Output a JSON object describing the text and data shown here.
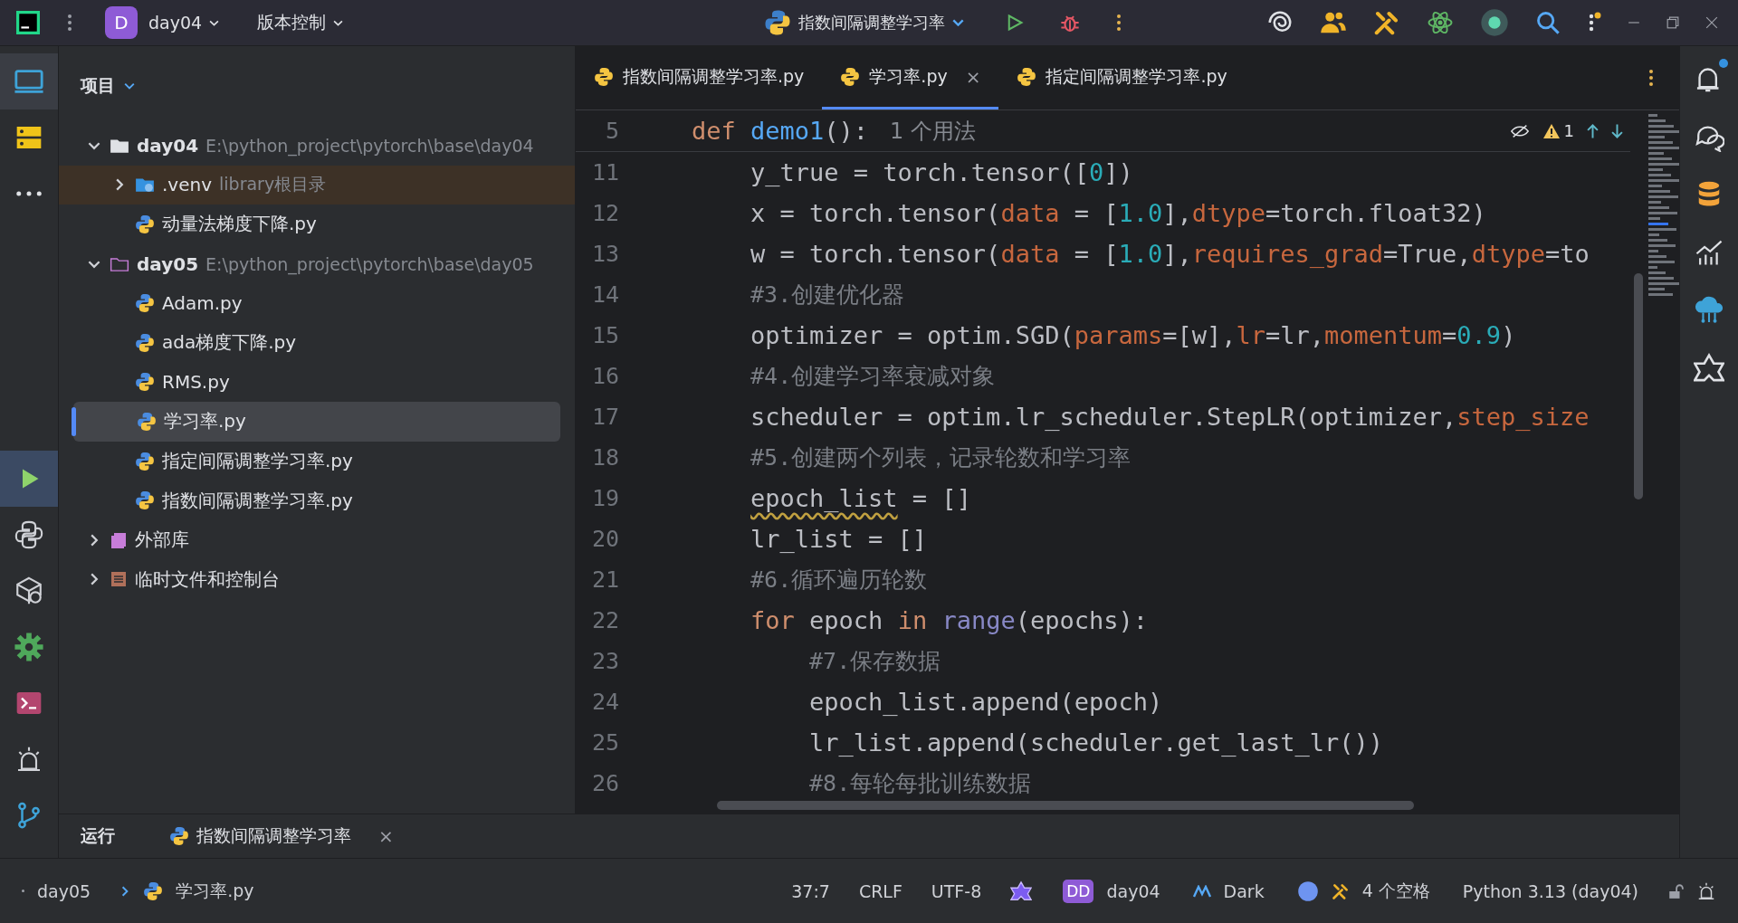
{
  "title_bar": {
    "project_badge": "D",
    "project": "day04",
    "vcs": "版本控制",
    "run_config": "指数间隔调整学习率"
  },
  "sidebar_left": {
    "top": [
      {
        "kind": "project",
        "selected": true
      },
      {
        "kind": "structure",
        "selected": false
      },
      {
        "kind": "more",
        "selected": false
      }
    ],
    "bottom": [
      {
        "kind": "run",
        "selected": true
      },
      {
        "kind": "python",
        "selected": false
      },
      {
        "kind": "packages",
        "selected": false
      },
      {
        "kind": "settings",
        "selected": false
      },
      {
        "kind": "terminal",
        "selected": false
      },
      {
        "kind": "alert",
        "selected": false
      },
      {
        "kind": "git",
        "selected": false
      }
    ]
  },
  "project_panel": {
    "title": "项目",
    "tree": [
      {
        "label": "day04",
        "path": "E:\\python_project\\pytorch\\base\\day04",
        "kind": "folder",
        "expanded": true,
        "selected": false,
        "children": [
          {
            "label": ".venv",
            "path": "library根目录",
            "kind": "venv",
            "expanded": false,
            "selected": false
          },
          {
            "label": "动量法梯度下降.py",
            "kind": "file",
            "selected": false
          }
        ]
      },
      {
        "label": "day05",
        "path": "E:\\python_project\\pytorch\\base\\day05",
        "kind": "module",
        "expanded": true,
        "selected": false,
        "children": [
          {
            "label": "Adam.py",
            "kind": "file",
            "selected": false
          },
          {
            "label": "ada梯度下降.py",
            "kind": "file",
            "selected": false
          },
          {
            "label": "RMS.py",
            "kind": "file",
            "selected": false
          },
          {
            "label": "学习率.py",
            "kind": "file",
            "selected": true
          },
          {
            "label": "指定间隔调整学习率.py",
            "kind": "file",
            "selected": false
          },
          {
            "label": "指数间隔调整学习率.py",
            "kind": "file",
            "selected": false
          }
        ]
      },
      {
        "label": "外部库",
        "kind": "library",
        "expanded": false,
        "selected": false
      },
      {
        "label": "临时文件和控制台",
        "kind": "scratch",
        "expanded": false,
        "selected": false
      }
    ]
  },
  "tabs": [
    {
      "label": "指数间隔调整学习率.py",
      "selected": false
    },
    {
      "label": "学习率.py",
      "selected": true,
      "close": "×"
    },
    {
      "label": "指定间隔调整学习率.py",
      "selected": false
    }
  ],
  "editor": {
    "sticky": {
      "number": "5",
      "segments": [
        {
          "text": "def ",
          "kind": "kw"
        },
        {
          "text": "demo1",
          "kind": "fn"
        },
        {
          "text": "():",
          "kind": "plain"
        }
      ],
      "hint": "1 个用法"
    },
    "inspection": {
      "warnings": "1"
    },
    "lines": [
      {
        "number": "11",
        "segments": [
          {
            "text": "    y_true = torch.tensor([",
            "kind": "plain"
          },
          {
            "text": "0",
            "kind": "num"
          },
          {
            "text": "])",
            "kind": "plain"
          }
        ]
      },
      {
        "number": "12",
        "segments": [
          {
            "text": "    x = torch.tensor(",
            "kind": "plain"
          },
          {
            "text": "data",
            "kind": "param"
          },
          {
            "text": " = [",
            "kind": "plain"
          },
          {
            "text": "1.0",
            "kind": "num"
          },
          {
            "text": "],",
            "kind": "plain"
          },
          {
            "text": "dtype",
            "kind": "param"
          },
          {
            "text": "=torch.float32)",
            "kind": "plain"
          }
        ]
      },
      {
        "number": "13",
        "segments": [
          {
            "text": "    w = torch.tensor(",
            "kind": "plain"
          },
          {
            "text": "data",
            "kind": "param"
          },
          {
            "text": " = [",
            "kind": "plain"
          },
          {
            "text": "1.0",
            "kind": "num"
          },
          {
            "text": "],",
            "kind": "plain"
          },
          {
            "text": "requires_grad",
            "kind": "param"
          },
          {
            "text": "=True,",
            "kind": "plain"
          },
          {
            "text": "dtype",
            "kind": "param"
          },
          {
            "text": "=to",
            "kind": "plain"
          }
        ]
      },
      {
        "number": "14",
        "segments": [
          {
            "text": "    #3.创建优化器",
            "kind": "comment"
          }
        ]
      },
      {
        "number": "15",
        "segments": [
          {
            "text": "    optimizer = optim.SGD(",
            "kind": "plain"
          },
          {
            "text": "params",
            "kind": "param"
          },
          {
            "text": "=[w],",
            "kind": "plain"
          },
          {
            "text": "lr",
            "kind": "param"
          },
          {
            "text": "=lr,",
            "kind": "plain"
          },
          {
            "text": "momentum",
            "kind": "param"
          },
          {
            "text": "=",
            "kind": "plain"
          },
          {
            "text": "0.9",
            "kind": "num"
          },
          {
            "text": ")",
            "kind": "plain"
          }
        ]
      },
      {
        "number": "16",
        "segments": [
          {
            "text": "    #4.创建学习率衰减对象",
            "kind": "comment"
          }
        ]
      },
      {
        "number": "17",
        "segments": [
          {
            "text": "    scheduler = optim.lr_scheduler.StepLR(optimizer,",
            "kind": "plain"
          },
          {
            "text": "step_size",
            "kind": "param"
          }
        ]
      },
      {
        "number": "18",
        "segments": [
          {
            "text": "    #5.创建两个列表，记录轮数和学习率",
            "kind": "comment"
          }
        ]
      },
      {
        "number": "19",
        "segments": [
          {
            "text": "    epoch_list",
            "kind": "warn"
          },
          {
            "text": " = []",
            "kind": "plain"
          }
        ]
      },
      {
        "number": "20",
        "segments": [
          {
            "text": "    lr_list = []",
            "kind": "plain"
          }
        ]
      },
      {
        "number": "21",
        "segments": [
          {
            "text": "    #6.循环遍历轮数",
            "kind": "comment"
          }
        ]
      },
      {
        "number": "22",
        "segments": [
          {
            "text": "    for",
            "kind": "kw"
          },
          {
            "text": " epoch ",
            "kind": "plain"
          },
          {
            "text": "in",
            "kind": "kw"
          },
          {
            "text": " range",
            "kind": "builtin"
          },
          {
            "text": "(epochs):",
            "kind": "plain"
          }
        ]
      },
      {
        "number": "23",
        "segments": [
          {
            "text": "        #7.保存数据",
            "kind": "comment"
          }
        ]
      },
      {
        "number": "24",
        "segments": [
          {
            "text": "        epoch_list.append(epoch)",
            "kind": "plain"
          }
        ]
      },
      {
        "number": "25",
        "segments": [
          {
            "text": "        lr_list.append(scheduler.get_last_lr())",
            "kind": "plain"
          }
        ]
      },
      {
        "number": "26",
        "segments": [
          {
            "text": "        #8.每轮每批训练数据",
            "kind": "comment"
          }
        ]
      }
    ]
  },
  "right_strip": [
    {
      "kind": "notifications",
      "badge": true
    },
    {
      "kind": "ai-chat"
    },
    {
      "kind": "database"
    },
    {
      "kind": "chart"
    },
    {
      "kind": "cloud"
    },
    {
      "kind": "assistant"
    }
  ],
  "run_panel": {
    "title": "运行",
    "tab": "指数间隔调整学习率",
    "close": "×"
  },
  "status_bar": {
    "breadcrumb": [
      "day05",
      "学习率.py"
    ],
    "position": "37:7",
    "line_ending": "CRLF",
    "encoding": "UTF-8",
    "vcs_badge": "DD",
    "vcs": "day04",
    "theme": "Dark",
    "indent": "4 个空格",
    "interpreter": "Python 3.13 (day04)"
  }
}
